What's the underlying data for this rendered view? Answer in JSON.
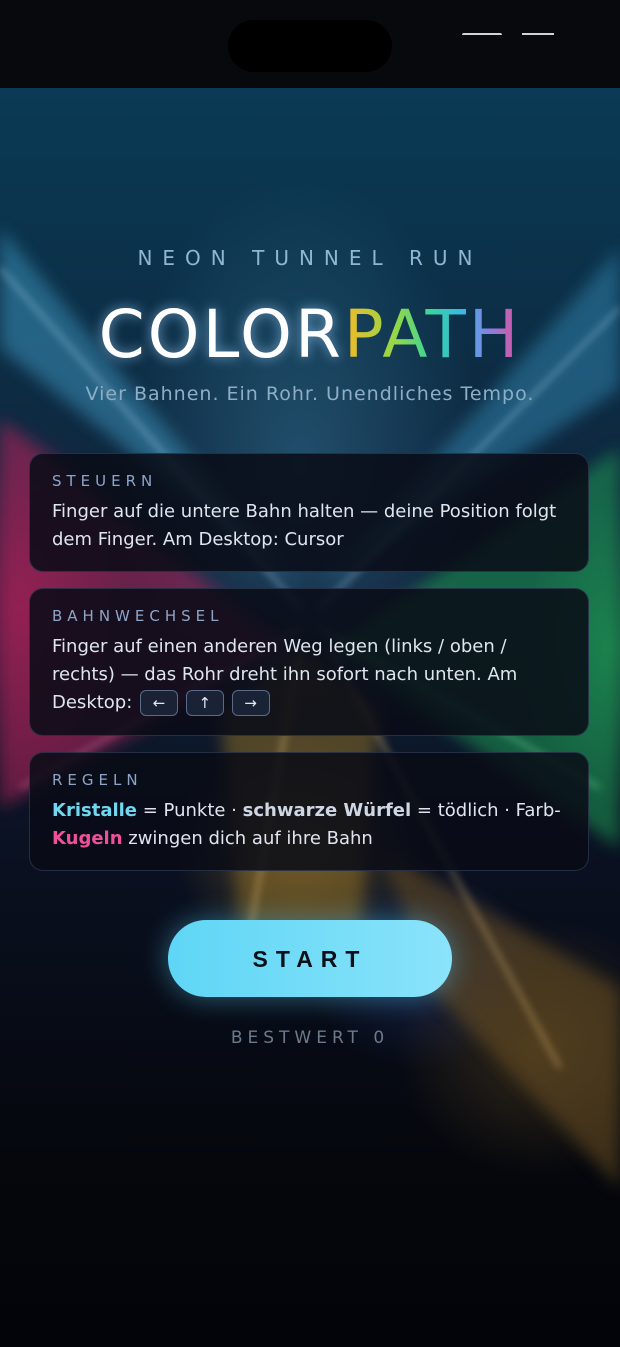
{
  "header": {
    "kicker": "NEON TUNNEL RUN",
    "title_part1": "COLOR",
    "title_part2": "PATH",
    "tagline": "Vier Bahnen. Ein Rohr. Unendliches Tempo."
  },
  "cards": {
    "controls": {
      "heading": "STEUERN",
      "text": "Finger auf die untere Bahn halten — deine Position folgt dem Finger. Am Desktop: Cursor"
    },
    "lane_change": {
      "heading": "BAHNWECHSEL",
      "text": "Finger auf einen anderen Weg legen (links / oben / rechts) — das Rohr dreht ihn sofort nach unten. Am Desktop:",
      "keys": [
        "←",
        "↑",
        "→"
      ]
    },
    "rules": {
      "heading": "REGELN",
      "crystals": "Kristalle",
      "t1": " = Punkte · ",
      "cubes": "schwarze Würfel",
      "t2": " = tödlich · Farb-",
      "balls": "Kugeln",
      "t3": " zwingen dich auf ihre Bahn"
    }
  },
  "start_button": {
    "label": "START"
  },
  "best": {
    "label": "BESTWERT",
    "value": "0"
  },
  "colors": {
    "accent": "#6fd8f0",
    "button": "#7ddff8",
    "danger_pink": "#f0509a"
  }
}
